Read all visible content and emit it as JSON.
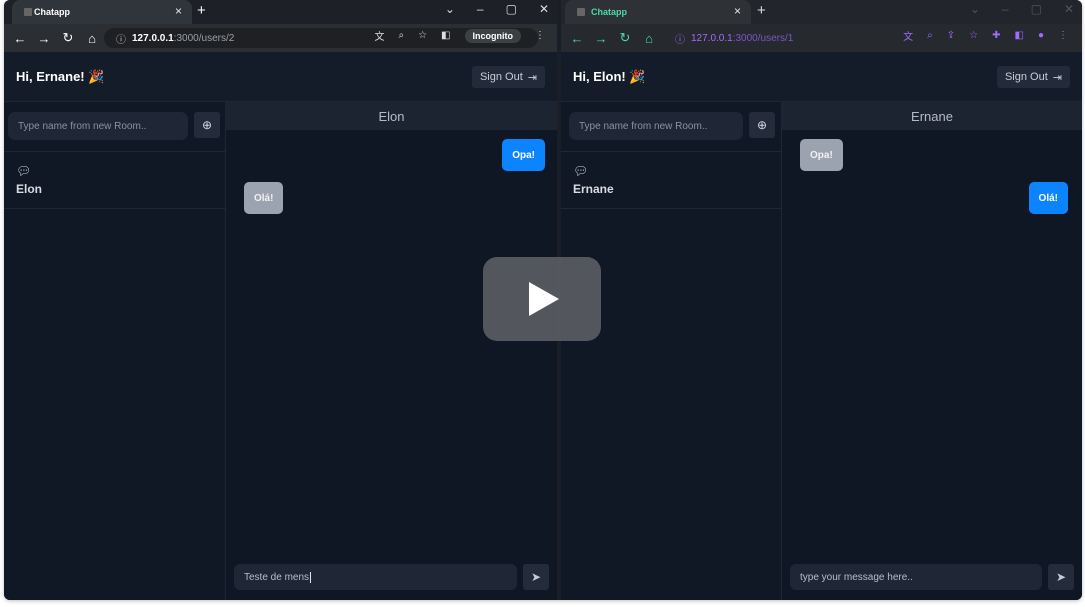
{
  "left": {
    "tab_title": "Chatapp",
    "url_host": "127.0.0.1",
    "url_rest": ":3000/users/2",
    "incognito_label": "Incognito",
    "greeting": "Hi, Ernane! 🎉",
    "signout_label": "Sign Out",
    "search_placeholder": "Type name from new Room..",
    "room_name": "Elon",
    "chat_title": "Elon",
    "messages": [
      {
        "text": "Opa!",
        "from": "me"
      },
      {
        "text": "Olá!",
        "from": "them"
      }
    ],
    "composer_value": "Teste de mens"
  },
  "right": {
    "tab_title": "Chatapp",
    "url_host": "127.0.0.1",
    "url_rest": ":3000/users/1",
    "greeting": "Hi, Elon! 🎉",
    "signout_label": "Sign Out",
    "search_placeholder": "Type name from new Room..",
    "room_name": "Ernane",
    "chat_title": "Ernane",
    "messages": [
      {
        "text": "Opa!",
        "from": "them"
      },
      {
        "text": "Olá!",
        "from": "me"
      }
    ],
    "composer_placeholder": "type your message here.."
  },
  "icons": {
    "back": "arrow-left-icon",
    "forward": "arrow-right-icon",
    "reload": "reload-icon",
    "home": "home-icon",
    "send": "send-icon",
    "add": "plus-circle-icon",
    "chat": "chat-bubble-icon",
    "play": "play-icon"
  },
  "colors": {
    "accent": "#0d84ff",
    "background": "#0f1624",
    "incoming_bubble": "#9ca3b0"
  }
}
